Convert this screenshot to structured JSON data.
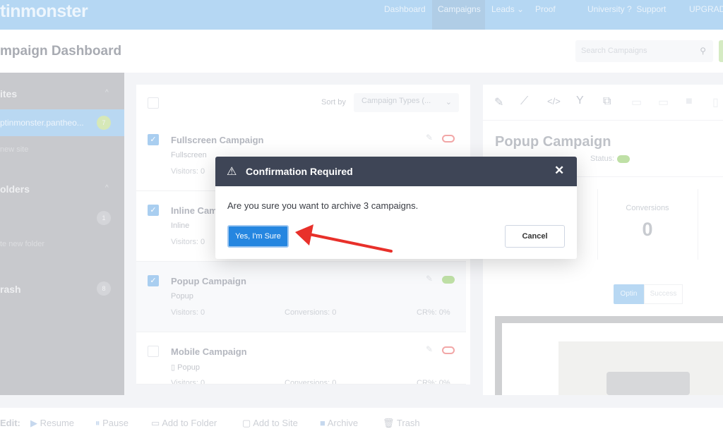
{
  "header": {
    "logo": "tinmonster",
    "nav": [
      "Dashboard",
      "Campaigns",
      "Leads",
      "Proof",
      "University",
      "Support",
      "UPGRADE"
    ],
    "active_nav": "Campaigns"
  },
  "page": {
    "title": "mpaign Dashboard",
    "search_placeholder": "Search Campaigns"
  },
  "sidebar": {
    "sites_label": "ites",
    "site_name": "ptinmonster.pantheo...",
    "site_count": "7",
    "add_site": "new site",
    "folders_label": "olders",
    "folder_count": "1",
    "new_folder": "te new folder",
    "trash_label": "rash",
    "trash_count": "8"
  },
  "list": {
    "sort_label": "Sort by",
    "sort_value": "Campaign Types (...",
    "campaigns": [
      {
        "name": "Fullscreen Campaign",
        "type": "Fullscreen",
        "visitors": "Visitors:  0",
        "conversions": "",
        "cr": "",
        "checked": true,
        "status": "off"
      },
      {
        "name": "Inline Campaign",
        "type": "Inline",
        "visitors": "Visitors:  0",
        "conversions": "",
        "cr": "",
        "checked": true,
        "status": "off"
      },
      {
        "name": "Popup Campaign",
        "type": "Popup",
        "visitors": "Visitors:  0",
        "conversions": "Conversions:  0",
        "cr": "CR%:  0%",
        "checked": true,
        "status": "on"
      },
      {
        "name": "Mobile Campaign",
        "type": "Popup",
        "visitors": "Visitors:  0",
        "conversions": "Conversions:  0",
        "cr": "CR%:  0%",
        "checked": false,
        "status": "off"
      }
    ]
  },
  "detail": {
    "title": "Popup Campaign",
    "status_label": "Status:",
    "status": "on",
    "stat_label": "Conversions",
    "stat_value": "0",
    "tab_optin": "Optin",
    "tab_success": "Success"
  },
  "footer": {
    "edit_label": "Edit:",
    "actions": [
      "Resume",
      "Pause",
      "Add to Folder",
      "Add to Site",
      "Archive",
      "Trash"
    ]
  },
  "modal": {
    "title": "Confirmation Required",
    "message": "Are you sure you want to archive 3 campaigns.",
    "confirm": "Yes, I'm Sure",
    "cancel": "Cancel"
  },
  "colors": {
    "header": "#3e4556",
    "confirm": "#2586e0",
    "arrow": "#e8302a"
  }
}
